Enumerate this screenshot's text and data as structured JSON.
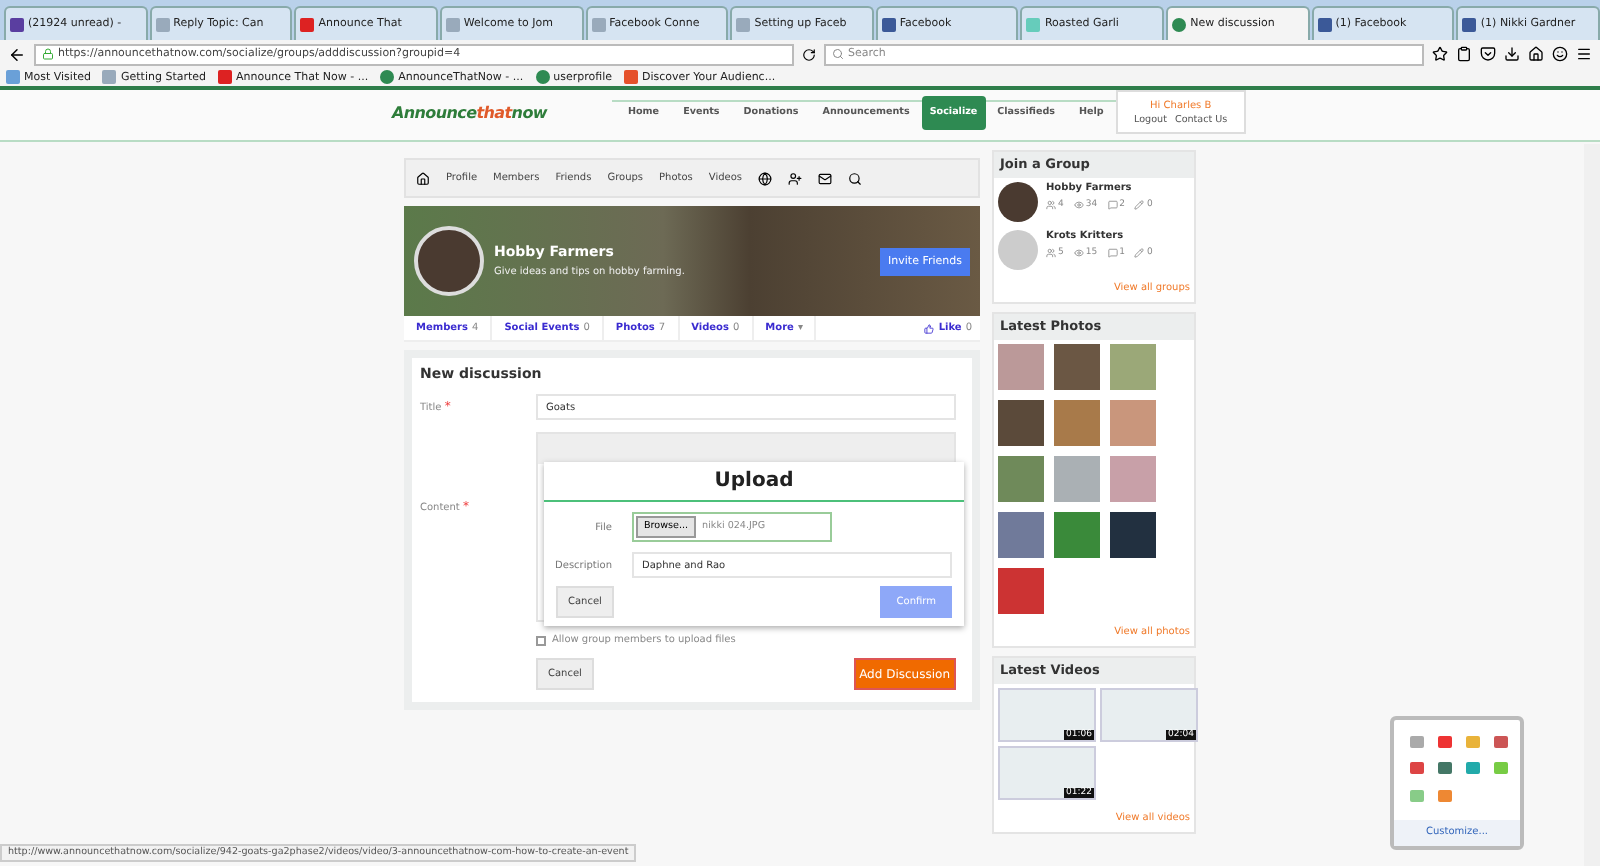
{
  "browser": {
    "tabs": [
      {
        "label": "(21924 unread) -",
        "selected": false
      },
      {
        "label": "Reply Topic: Can",
        "selected": false
      },
      {
        "label": "Announce That",
        "selected": false
      },
      {
        "label": "Welcome to Jom",
        "selected": false
      },
      {
        "label": "Facebook Conne",
        "selected": false
      },
      {
        "label": "Setting up Faceb",
        "selected": false
      },
      {
        "label": "Facebook",
        "selected": false
      },
      {
        "label": "Roasted Garli",
        "selected": false
      },
      {
        "label": "New discussion",
        "selected": true
      },
      {
        "label": "(1) Facebook",
        "selected": false
      },
      {
        "label": "(1) Nikki Gardner",
        "selected": false
      }
    ],
    "address": "https://announcethatnow.com/socialize/groups/adddiscussion?groupid=4",
    "search_placeholder": "Search",
    "bookmarks": [
      "Most Visited",
      "Getting Started",
      "Announce That Now - ...",
      "AnnounceThatNow - ...",
      "userprofile",
      "Discover Your Audienc..."
    ]
  },
  "header": {
    "logo": [
      "Announce",
      "that",
      "now"
    ],
    "nav": [
      {
        "label": "Home",
        "selected": false
      },
      {
        "label": "Events",
        "selected": false
      },
      {
        "label": "Donations",
        "selected": false
      },
      {
        "label": "Announcements",
        "selected": false
      },
      {
        "label": "Socialize",
        "selected": true
      },
      {
        "label": "Classifieds",
        "selected": false
      },
      {
        "label": "Help",
        "selected": false
      }
    ],
    "greeting": "Hi Charles B",
    "links": [
      "Logout",
      "Contact Us"
    ]
  },
  "group": {
    "toolbar": [
      "Profile",
      "Members",
      "Friends",
      "Groups",
      "Photos",
      "Videos"
    ],
    "title": "Hobby Farmers",
    "description": "Give ideas and tips on hobby farming.",
    "invite": "Invite Friends",
    "stats": [
      {
        "label": "Members",
        "count": "4"
      },
      {
        "label": "Social Events",
        "count": "0"
      },
      {
        "label": "Photos",
        "count": "7"
      },
      {
        "label": "Videos",
        "count": "0"
      }
    ],
    "more": "More",
    "more_caret": "▾",
    "like": "Like",
    "like_count": "0"
  },
  "form": {
    "heading": "New discussion",
    "required_mark": "*",
    "title_label": "Title",
    "title_value": "Goats",
    "content_label": "Content",
    "upload": {
      "title": "Upload",
      "file_label": "File",
      "browse": "Browse...",
      "file_name": "nikki 024.JPG",
      "description_label": "Description",
      "description_value": "Daphne and Rao",
      "cancel": "Cancel",
      "confirm": "Confirm"
    },
    "allow_uploads": {
      "label": "Allow group members to upload files",
      "checked": false
    },
    "cancel": "Cancel",
    "submit": "Add Discussion"
  },
  "sidebar": {
    "groups_title": "Join a Group",
    "groups": [
      {
        "name": "Hobby Farmers",
        "members": "4",
        "views": "34",
        "comments": "2",
        "edits": "0"
      },
      {
        "name": "Krots Kritters",
        "members": "5",
        "views": "15",
        "comments": "1",
        "edits": "0"
      }
    ],
    "view_groups": "View all groups",
    "photos_title": "Latest Photos",
    "view_photos": "View all photos",
    "videos_title": "Latest Videos",
    "videos": [
      "01:06",
      "02:04",
      "01:22"
    ],
    "view_videos": "View all videos"
  },
  "tray": {
    "customize": "Customize..."
  },
  "status_url": "http://www.announcethatnow.com/socialize/942-goats-ga2phase2/videos/video/3-announcethatnow-com-how-to-create-an-event"
}
